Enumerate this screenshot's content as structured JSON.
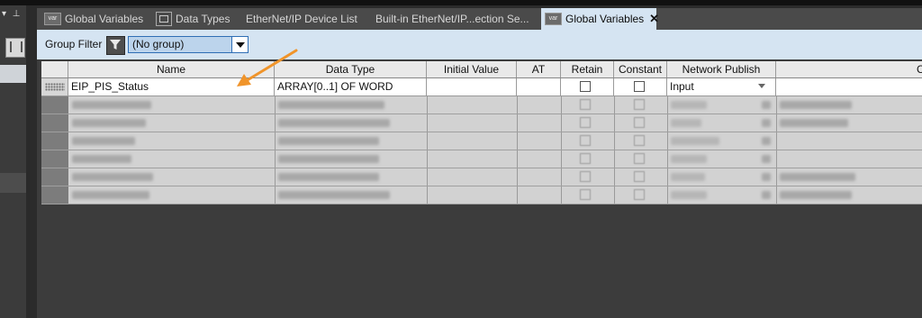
{
  "tabs": [
    {
      "label": "Global Variables",
      "icon": "var-icon",
      "active": false
    },
    {
      "label": "Data Types",
      "icon": "datatype-icon",
      "active": false
    },
    {
      "label": "EtherNet/IP Device List",
      "active": false
    },
    {
      "label": "Built-in EtherNet/IP...ection Se...",
      "active": false
    },
    {
      "label": "Global Variables",
      "icon": "var-icon",
      "active": true,
      "close": "✕"
    }
  ],
  "filter": {
    "label": "Group Filter",
    "value": "(No group)"
  },
  "columns": [
    "Name",
    "Data Type",
    "Initial Value",
    "AT",
    "Retain",
    "Constant",
    "Network Publish",
    "C"
  ],
  "rows": [
    {
      "name": "EIP_PIS_Status",
      "data_type": "ARRAY[0..1] OF WORD",
      "initial_value": "",
      "at": "",
      "retain": false,
      "constant": false,
      "network_publish": "Input",
      "comment": ""
    }
  ],
  "icon_text": {
    "var": "var"
  },
  "accent_color": "#2f6eb5",
  "arrow_color": "#f0942a"
}
